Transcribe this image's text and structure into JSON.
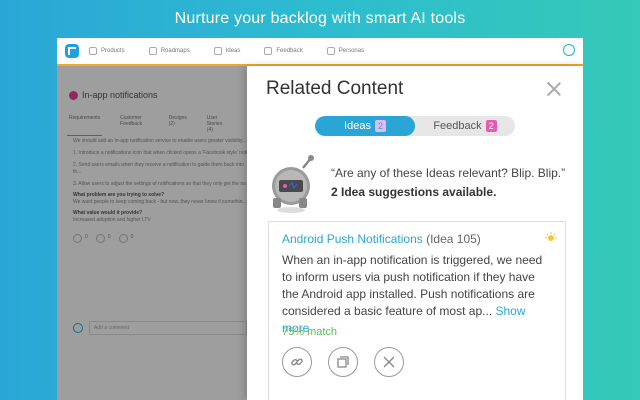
{
  "headline": "Nurture your backlog with smart AI tools",
  "nav": {
    "items": [
      "Products",
      "Roadmaps",
      "Ideas",
      "Feedback",
      "Personas"
    ]
  },
  "left": {
    "title": "In-app notifications",
    "tabs": [
      "Requirements",
      "Customer Feedback",
      "Designs (2)",
      "User Stories (4)"
    ],
    "paragraph": "We should add an in-app notification service to enable users greater visibility...",
    "list": [
      "1. Introduce a notifications icon that when clicked opens a 'Facebook style' notif...",
      "2. Send users emails when they receive a notification to guide them back into th...",
      "3. Allow users to adjust the settings of notifications so that they only get the no..."
    ],
    "problem_heading": "What problem are you trying to solve?",
    "problem_text": "We want people to keep coming back - but now, they never know if somethin...",
    "value_heading": "What value would it provide?",
    "value_text": "Increased adoption and higher LTV",
    "stats": [
      "0",
      "0",
      "0"
    ],
    "comment_placeholder": "Add a comment"
  },
  "panel": {
    "title": "Related Content",
    "tabs": [
      {
        "label": "Ideas",
        "count": "2"
      },
      {
        "label": "Feedback",
        "count": "2"
      }
    ],
    "robot_message": "“Are any of these Ideas relevant? Blip. Blip.”",
    "suggestions": "2 Idea suggestions available.",
    "card": {
      "title": "Android Push Notifications",
      "idea_ref": "(Idea 105)",
      "description": "When an in-app notification is triggered, we need to inform users via push notification if they have the Android app installed.  Push notifications are considered a basic feature of most ap...",
      "show_more": "Show more",
      "match": "75% match"
    }
  },
  "colors": {
    "accent": "#2aa6d6",
    "badge": "#e95bb0",
    "match": "#5cb85c",
    "nav_underline": "#f5a623"
  }
}
